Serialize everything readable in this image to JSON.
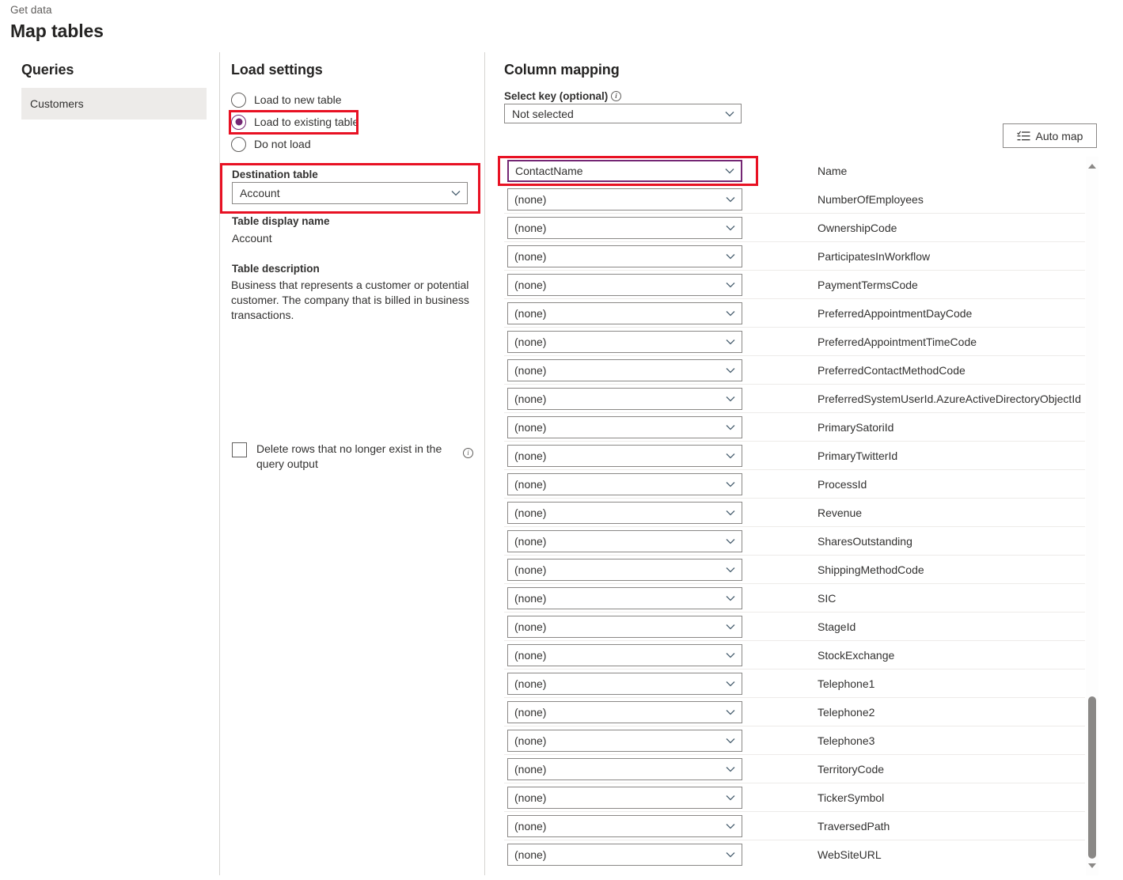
{
  "header": {
    "breadcrumb": "Get data",
    "title": "Map tables"
  },
  "queries": {
    "title": "Queries",
    "items": [
      {
        "label": "Customers",
        "selected": true
      }
    ]
  },
  "load_settings": {
    "title": "Load settings",
    "radio_options": [
      {
        "label": "Load to new table",
        "selected": false
      },
      {
        "label": "Load to existing table",
        "selected": true
      },
      {
        "label": "Do not load",
        "selected": false
      }
    ],
    "destination_table": {
      "label": "Destination table",
      "value": "Account"
    },
    "table_display_name": {
      "label": "Table display name",
      "value": "Account"
    },
    "table_description": {
      "label": "Table description",
      "value": "Business that represents a customer or potential customer. The company that is billed in business transactions."
    },
    "delete_rows_checkbox": {
      "label": "Delete rows that no longer exist in the query output",
      "checked": false,
      "info_icon": "info-icon"
    }
  },
  "column_mapping": {
    "title": "Column mapping",
    "select_key": {
      "label": "Select key (optional)",
      "info_icon": "info-icon",
      "value": "Not selected"
    },
    "auto_map_button": {
      "label": "Auto map",
      "icon": "auto-map-icon"
    },
    "none_value": "(none)",
    "rows": [
      {
        "source": "ContactName",
        "target": "Name",
        "selected": true
      },
      {
        "source": "(none)",
        "target": "NumberOfEmployees",
        "selected": false
      },
      {
        "source": "(none)",
        "target": "OwnershipCode",
        "selected": false
      },
      {
        "source": "(none)",
        "target": "ParticipatesInWorkflow",
        "selected": false
      },
      {
        "source": "(none)",
        "target": "PaymentTermsCode",
        "selected": false
      },
      {
        "source": "(none)",
        "target": "PreferredAppointmentDayCode",
        "selected": false
      },
      {
        "source": "(none)",
        "target": "PreferredAppointmentTimeCode",
        "selected": false
      },
      {
        "source": "(none)",
        "target": "PreferredContactMethodCode",
        "selected": false
      },
      {
        "source": "(none)",
        "target": "PreferredSystemUserId.AzureActiveDirectoryObjectId",
        "selected": false
      },
      {
        "source": "(none)",
        "target": "PrimarySatoriId",
        "selected": false
      },
      {
        "source": "(none)",
        "target": "PrimaryTwitterId",
        "selected": false
      },
      {
        "source": "(none)",
        "target": "ProcessId",
        "selected": false
      },
      {
        "source": "(none)",
        "target": "Revenue",
        "selected": false
      },
      {
        "source": "(none)",
        "target": "SharesOutstanding",
        "selected": false
      },
      {
        "source": "(none)",
        "target": "ShippingMethodCode",
        "selected": false
      },
      {
        "source": "(none)",
        "target": "SIC",
        "selected": false
      },
      {
        "source": "(none)",
        "target": "StageId",
        "selected": false
      },
      {
        "source": "(none)",
        "target": "StockExchange",
        "selected": false
      },
      {
        "source": "(none)",
        "target": "Telephone1",
        "selected": false
      },
      {
        "source": "(none)",
        "target": "Telephone2",
        "selected": false
      },
      {
        "source": "(none)",
        "target": "Telephone3",
        "selected": false
      },
      {
        "source": "(none)",
        "target": "TerritoryCode",
        "selected": false
      },
      {
        "source": "(none)",
        "target": "TickerSymbol",
        "selected": false
      },
      {
        "source": "(none)",
        "target": "TraversedPath",
        "selected": false
      },
      {
        "source": "(none)",
        "target": "WebSiteURL",
        "selected": false
      }
    ],
    "scrollbar": {
      "up_arrow_icon": "scroll-up-icon",
      "down_arrow_icon": "scroll-down-icon"
    }
  },
  "colors": {
    "accent": "#742774",
    "highlight": "#e81123",
    "selection_bg": "#edebe9",
    "border": "#8a8886"
  }
}
